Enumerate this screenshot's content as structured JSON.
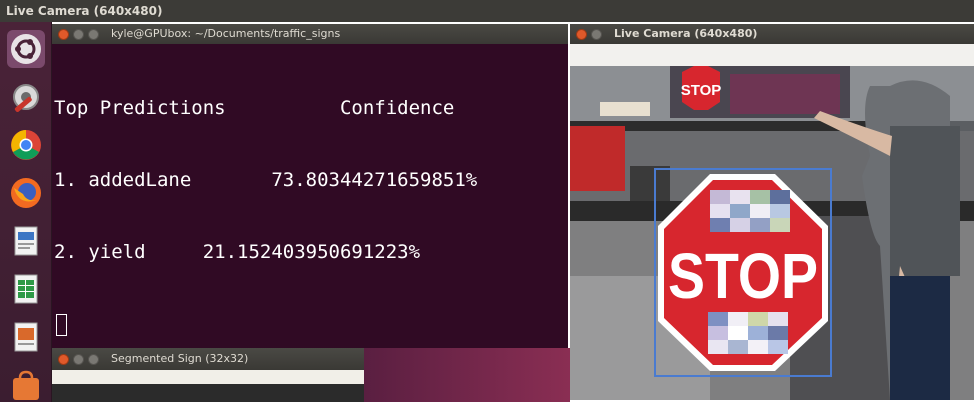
{
  "app": {
    "top_title": "Live Camera (640x480)"
  },
  "launcher": {
    "items": [
      {
        "icon": "dash-icon"
      },
      {
        "icon": "settings-icon"
      },
      {
        "icon": "chrome-icon"
      },
      {
        "icon": "firefox-icon"
      },
      {
        "icon": "writer-icon"
      },
      {
        "icon": "calc-icon"
      },
      {
        "icon": "impress-icon"
      },
      {
        "icon": "software-icon"
      }
    ]
  },
  "terminal": {
    "title": "kyle@GPUbox: ~/Documents/traffic_signs",
    "lines": [
      "Top Predictions          Confidence",
      "1. addedLane       73.80344271659851%",
      "2. yield     21.152403950691223%"
    ]
  },
  "segmented": {
    "title": "Segmented Sign (32x32)"
  },
  "camera": {
    "title": "Live Camera (640x480)",
    "sign_text": "STOP",
    "small_sign_text": "STOP"
  },
  "colors": {
    "terminal_bg": "#300a24",
    "titlebar": "#3c3b37",
    "close_button": "#e0592a",
    "stop_red": "#d7262e",
    "bbox_blue": "#4a7bd0"
  }
}
